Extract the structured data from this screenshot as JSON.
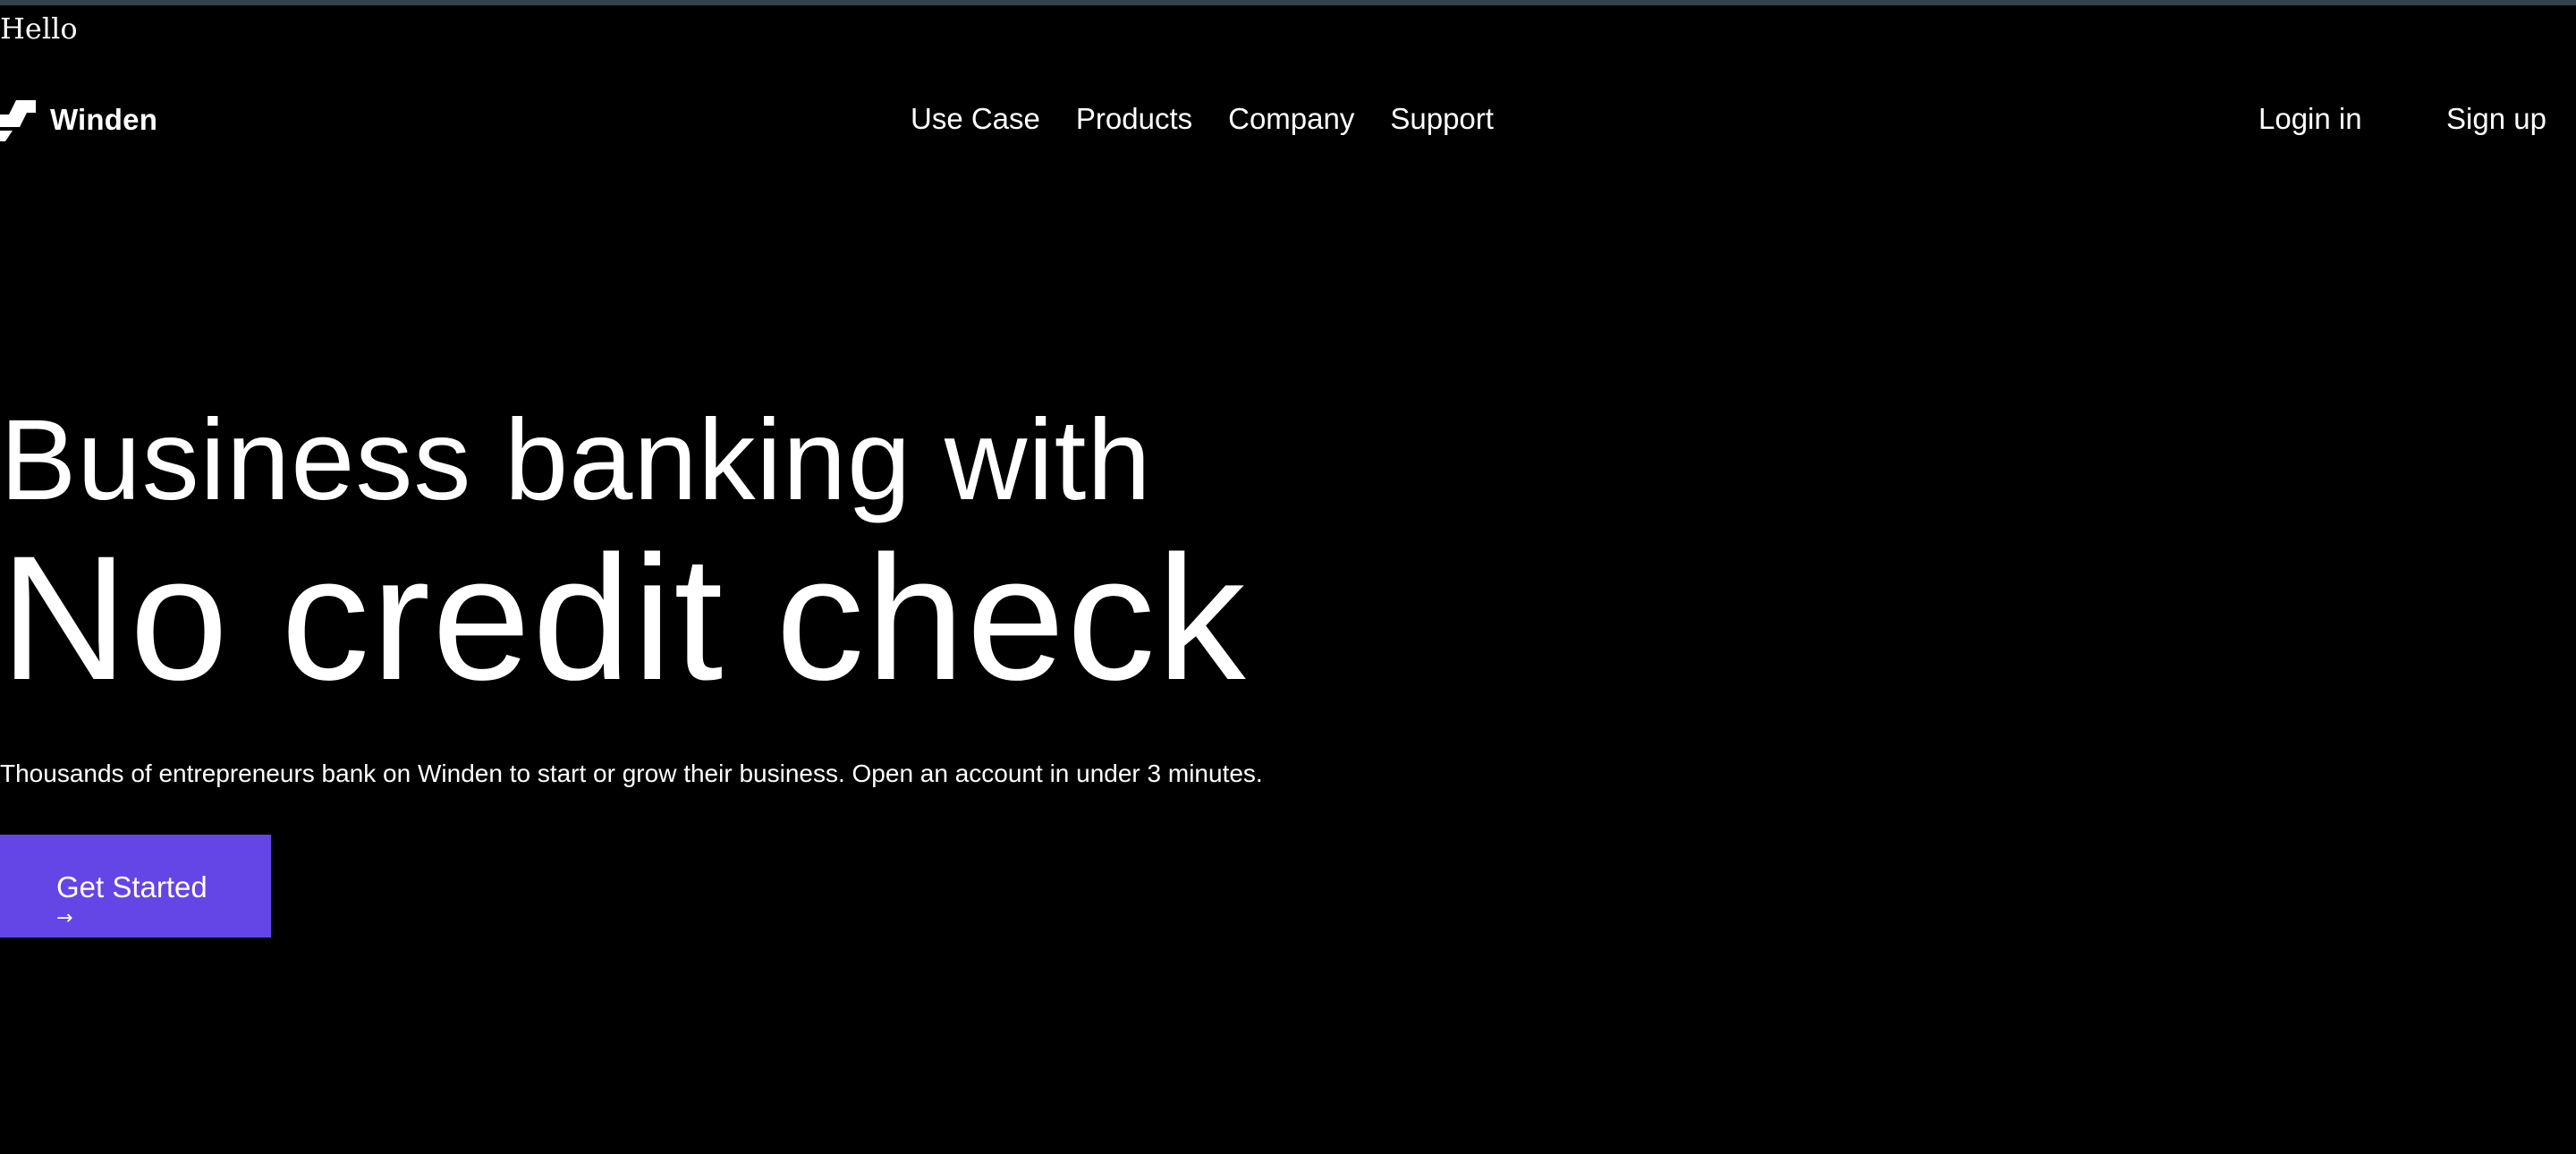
{
  "page": {
    "greeting": "Hello"
  },
  "brand": {
    "name": "Winden",
    "logo_icon": "winden-logo-icon"
  },
  "nav": {
    "items": [
      {
        "label": "Use Case"
      },
      {
        "label": "Products"
      },
      {
        "label": "Company"
      },
      {
        "label": "Support"
      }
    ]
  },
  "auth": {
    "login_label": "Login in",
    "signup_label": "Sign up"
  },
  "hero": {
    "headline_line1": "Business banking with",
    "headline_line2": "No credit check",
    "subtitle": "Thousands of entrepreneurs bank on Winden to start or grow their business. Open an account in under 3 minutes.",
    "cta_label": "Get Started",
    "cta_icon": "arrow-right-icon",
    "cta_arrow": "→"
  },
  "colors": {
    "background": "#000000",
    "text": "#ffffff",
    "accent": "#6445e6"
  }
}
